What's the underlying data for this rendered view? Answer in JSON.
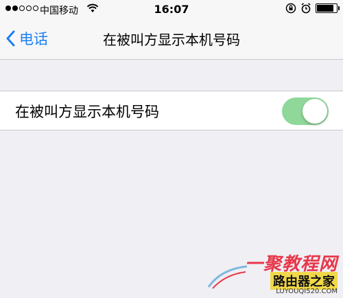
{
  "status_bar": {
    "carrier": "中国移动",
    "time": "16:07",
    "signal_bars_filled": 2,
    "signal_bars_total": 5,
    "battery_level": 0.85
  },
  "nav": {
    "back_label": "电话",
    "title": "在被叫方显示本机号码"
  },
  "setting": {
    "label": "在被叫方显示本机号码",
    "toggle_on": true
  },
  "watermark": {
    "line1": "一聚教程网",
    "line2": "路由器之家",
    "url": "LUYOUQI520.COM"
  },
  "colors": {
    "accent": "#1a7ff2",
    "toggle_on": "#8fd89a",
    "background": "#efeff4"
  },
  "icons": [
    "wifi-icon",
    "rotation-lock-icon",
    "alarm-icon",
    "battery-icon",
    "chevron-left-icon"
  ]
}
